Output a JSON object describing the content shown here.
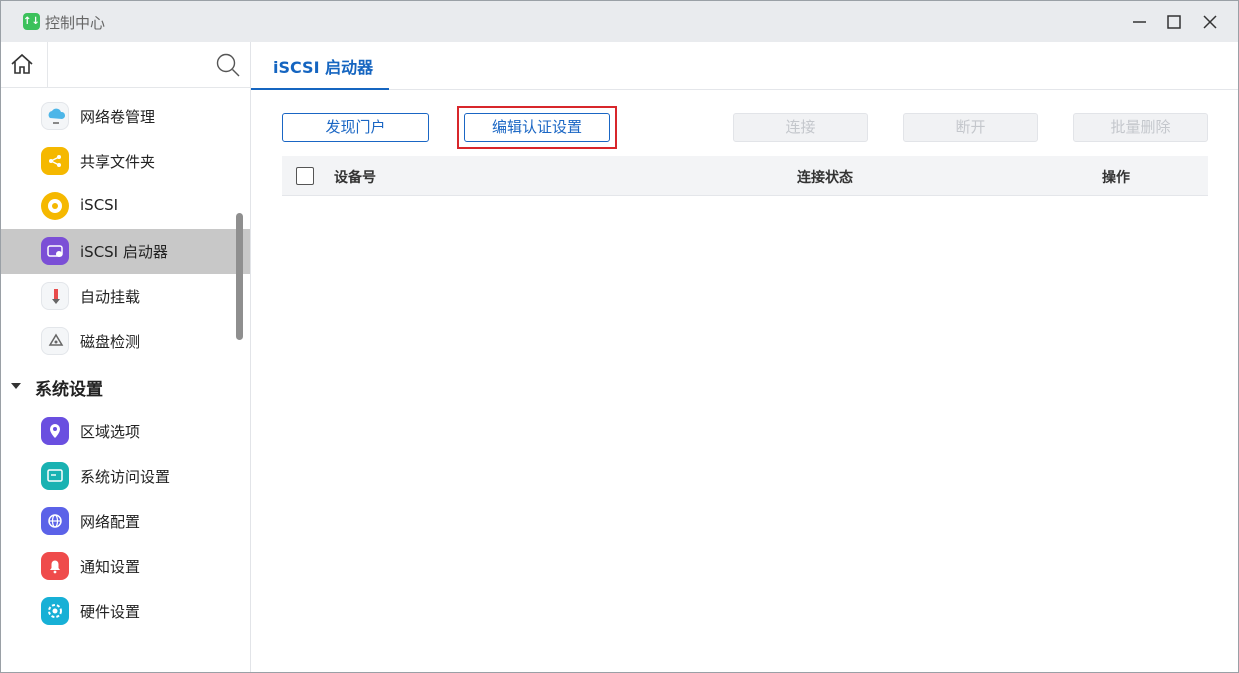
{
  "window": {
    "title": "控制中心",
    "app_icon_glyph": "↑↓"
  },
  "sidebar": {
    "items": [
      {
        "label": "网络卷管理",
        "icon": "cloud-volume-icon",
        "color": "#ffffff"
      },
      {
        "label": "共享文件夹",
        "icon": "shared-folder-icon",
        "color": "#f5b800"
      },
      {
        "label": "iSCSI",
        "icon": "iscsi-icon",
        "color": "#f5b800"
      },
      {
        "label": "iSCSI 启动器",
        "icon": "iscsi-initiator-icon",
        "color": "#7b4fd6",
        "active": true
      },
      {
        "label": "自动挂载",
        "icon": "auto-mount-icon",
        "color": "#ffffff"
      },
      {
        "label": "磁盘检测",
        "icon": "disk-check-icon",
        "color": "#ffffff"
      }
    ],
    "section": {
      "label": "系统设置"
    },
    "section_items": [
      {
        "label": "区域选项",
        "icon": "region-icon",
        "color": "#6a4fe0"
      },
      {
        "label": "系统访问设置",
        "icon": "system-access-icon",
        "color": "#19b2b2"
      },
      {
        "label": "网络配置",
        "icon": "network-config-icon",
        "color": "#5b62e8"
      },
      {
        "label": "通知设置",
        "icon": "notification-icon",
        "color": "#ef4b4b"
      },
      {
        "label": "硬件设置",
        "icon": "hardware-icon",
        "color": "#17b0d6"
      }
    ]
  },
  "main": {
    "tab": "iSCSI 启动器",
    "buttons": {
      "discover_portal": "发现门户",
      "edit_auth": "编辑认证设置",
      "connect": "连接",
      "disconnect": "断开",
      "batch_delete": "批量删除"
    },
    "table": {
      "columns": [
        "设备号",
        "连接状态",
        "操作"
      ]
    }
  },
  "colors": {
    "accent": "#1565c0",
    "highlight": "#d8262b"
  }
}
